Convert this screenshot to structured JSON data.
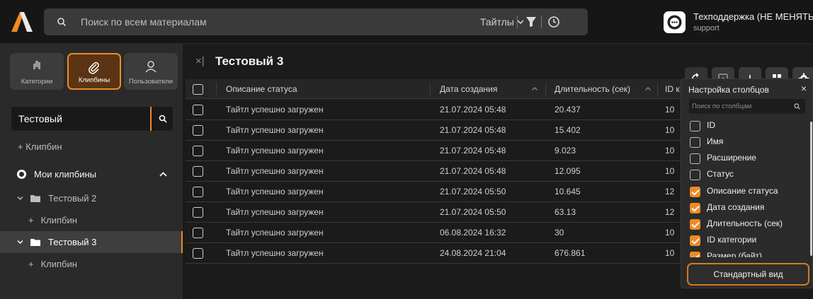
{
  "topbar": {
    "search_placeholder": "Поиск по всем материалам",
    "scope_select": "Тайтлы",
    "user_name": "Техподдержка (НЕ МЕНЯТЬ)",
    "user_role": "support"
  },
  "sidebar": {
    "nav": [
      {
        "label": "Категории",
        "icon": "categories-icon",
        "active": false
      },
      {
        "label": "Клипбины",
        "icon": "paperclip-icon",
        "active": true
      },
      {
        "label": "Пользователи",
        "icon": "user-icon",
        "active": false
      }
    ],
    "search_value": "Тестовый",
    "add_clipbin": "+ Клипбин",
    "section_title": "Мои клипбины",
    "tree": [
      {
        "label": "Тестовый 2",
        "add": "Клипбин",
        "selected": false
      },
      {
        "label": "Тестовый 3",
        "add": "Клипбин",
        "selected": true
      }
    ]
  },
  "main": {
    "title": "Тестовый 3",
    "close_symbol": "×|",
    "columns": {
      "description": "Описание статуса",
      "created": "Дата создания",
      "duration": "Длительность (сек)",
      "id": "ID к"
    },
    "rows": [
      {
        "description": "Тайтл успешно загружен",
        "created": "21.07.2024 05:48",
        "duration": "20.437",
        "id": "10"
      },
      {
        "description": "Тайтл успешно загружен",
        "created": "21.07.2024 05:48",
        "duration": "15.402",
        "id": "10"
      },
      {
        "description": "Тайтл успешно загружен",
        "created": "21.07.2024 05:48",
        "duration": "9.023",
        "id": "10"
      },
      {
        "description": "Тайтл успешно загружен",
        "created": "21.07.2024 05:48",
        "duration": "12.095",
        "id": "10"
      },
      {
        "description": "Тайтл успешно загружен",
        "created": "21.07.2024 05:50",
        "duration": "10.645",
        "id": "12"
      },
      {
        "description": "Тайтл успешно загружен",
        "created": "21.07.2024 05:50",
        "duration": "63.13",
        "id": "12"
      },
      {
        "description": "Тайтл успешно загружен",
        "created": "06.08.2024 16:32",
        "duration": "30",
        "id": "10"
      },
      {
        "description": "Тайтл успешно загружен",
        "created": "24.08.2024 21:04",
        "duration": "676.861",
        "id": "10"
      }
    ]
  },
  "column_settings": {
    "title": "Настройка столбцов",
    "close": "×",
    "search_placeholder": "Поиск по столбцам",
    "options": [
      {
        "label": "ID",
        "checked": false
      },
      {
        "label": "Имя",
        "checked": false
      },
      {
        "label": "Расширение",
        "checked": false
      },
      {
        "label": "Статус",
        "checked": false
      },
      {
        "label": "Описание статуса",
        "checked": true
      },
      {
        "label": "Дата создания",
        "checked": true
      },
      {
        "label": "Длительность (сек)",
        "checked": true
      },
      {
        "label": "ID категории",
        "checked": true
      },
      {
        "label": "Размер (байт)",
        "checked": true
      }
    ],
    "reset_button": "Стандартный вид"
  },
  "colors": {
    "accent": "#f08a24",
    "background": "#1b1b1b",
    "panel": "#2a2a2a"
  }
}
